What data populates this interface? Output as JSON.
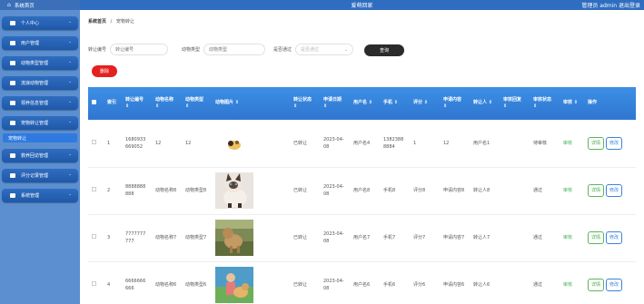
{
  "sidebar": {
    "home_label": "系统首页",
    "menus": [
      {
        "label": "个人中心",
        "icon": "person-icon"
      },
      {
        "label": "用户管理",
        "icon": "user-icon"
      },
      {
        "label": "动物类型管理",
        "icon": "tag-icon"
      },
      {
        "label": "流浪动物管理",
        "icon": "monitor-icon"
      },
      {
        "label": "领养信息管理",
        "icon": "grid-icon"
      },
      {
        "label": "宠物转让管理",
        "icon": "barcode-icon"
      }
    ],
    "active_sub": "宠物转让",
    "menus2": [
      {
        "label": "救养回访管理",
        "icon": "location-icon"
      },
      {
        "label": "评分记录管理",
        "icon": "grid-icon"
      },
      {
        "label": "系统管理",
        "icon": "grid-icon"
      }
    ]
  },
  "header": {
    "title": "爱萌回家",
    "user_info": "管理员 admin  退出登录"
  },
  "breadcrumb": {
    "home": "系统首页",
    "sep": "/",
    "current": "宠物转让"
  },
  "filters": {
    "code_label": "转让编号",
    "code_placeholder": "转让编号",
    "type_label": "动物类型",
    "type_placeholder": "动物类型",
    "pass_label": "是否通过",
    "pass_placeholder": "是否通过",
    "search_button": "查询"
  },
  "delete_button": "删除",
  "table": {
    "headers": [
      "索引",
      "转让编号 ⇕",
      "动物名称 ⇕",
      "动物类型 ⇕",
      "动物图片 ⇕",
      "转让状态 ⇕",
      "申请日期 ⇕",
      "用户名 ⇕",
      "手机 ⇕",
      "评分 ⇕",
      "申请内容 ⇕",
      "转让人 ⇕",
      "审核回复 ⇕",
      "审核状态 ⇕",
      "审核 ⇕",
      "操作"
    ],
    "rows": [
      {
        "index": "1",
        "code": "1680933669052",
        "name": "12",
        "type": "12",
        "status": "已转让",
        "date": "2023-04-08",
        "user": "用户名4",
        "phone": "13823888884",
        "score": "1",
        "content": "12",
        "transferor": "用户名1",
        "reply": "",
        "review_state": "待审核",
        "review": "审核",
        "detail": "详情",
        "edit": "修改",
        "img": "small"
      },
      {
        "index": "2",
        "code": "8888888888",
        "name": "动物名称8",
        "type": "动物类型8",
        "status": "已转让",
        "date": "2023-04-08",
        "user": "用户名8",
        "phone": "手机8",
        "score": "评分8",
        "content": "申请内容8",
        "transferor": "转让人8",
        "reply": "",
        "review_state": "通过",
        "review": "审核",
        "detail": "详情",
        "edit": "修改",
        "img": "cat"
      },
      {
        "index": "3",
        "code": "7777777777",
        "name": "动物名称7",
        "type": "动物类型7",
        "status": "已转让",
        "date": "2023-04-08",
        "user": "用户名7",
        "phone": "手机7",
        "score": "评分7",
        "content": "申请内容7",
        "transferor": "转让人7",
        "reply": "",
        "review_state": "通过",
        "review": "审核",
        "detail": "详情",
        "edit": "修改",
        "img": "dog"
      },
      {
        "index": "4",
        "code": "6666666666",
        "name": "动物名称6",
        "type": "动物类型6",
        "status": "已转让",
        "date": "2023-04-08",
        "user": "用户名6",
        "phone": "手机6",
        "score": "评分6",
        "content": "申请内容6",
        "transferor": "转让人6",
        "reply": "",
        "review_state": "通过",
        "review": "审核",
        "detail": "详情",
        "edit": "修改",
        "img": "girl"
      }
    ]
  }
}
